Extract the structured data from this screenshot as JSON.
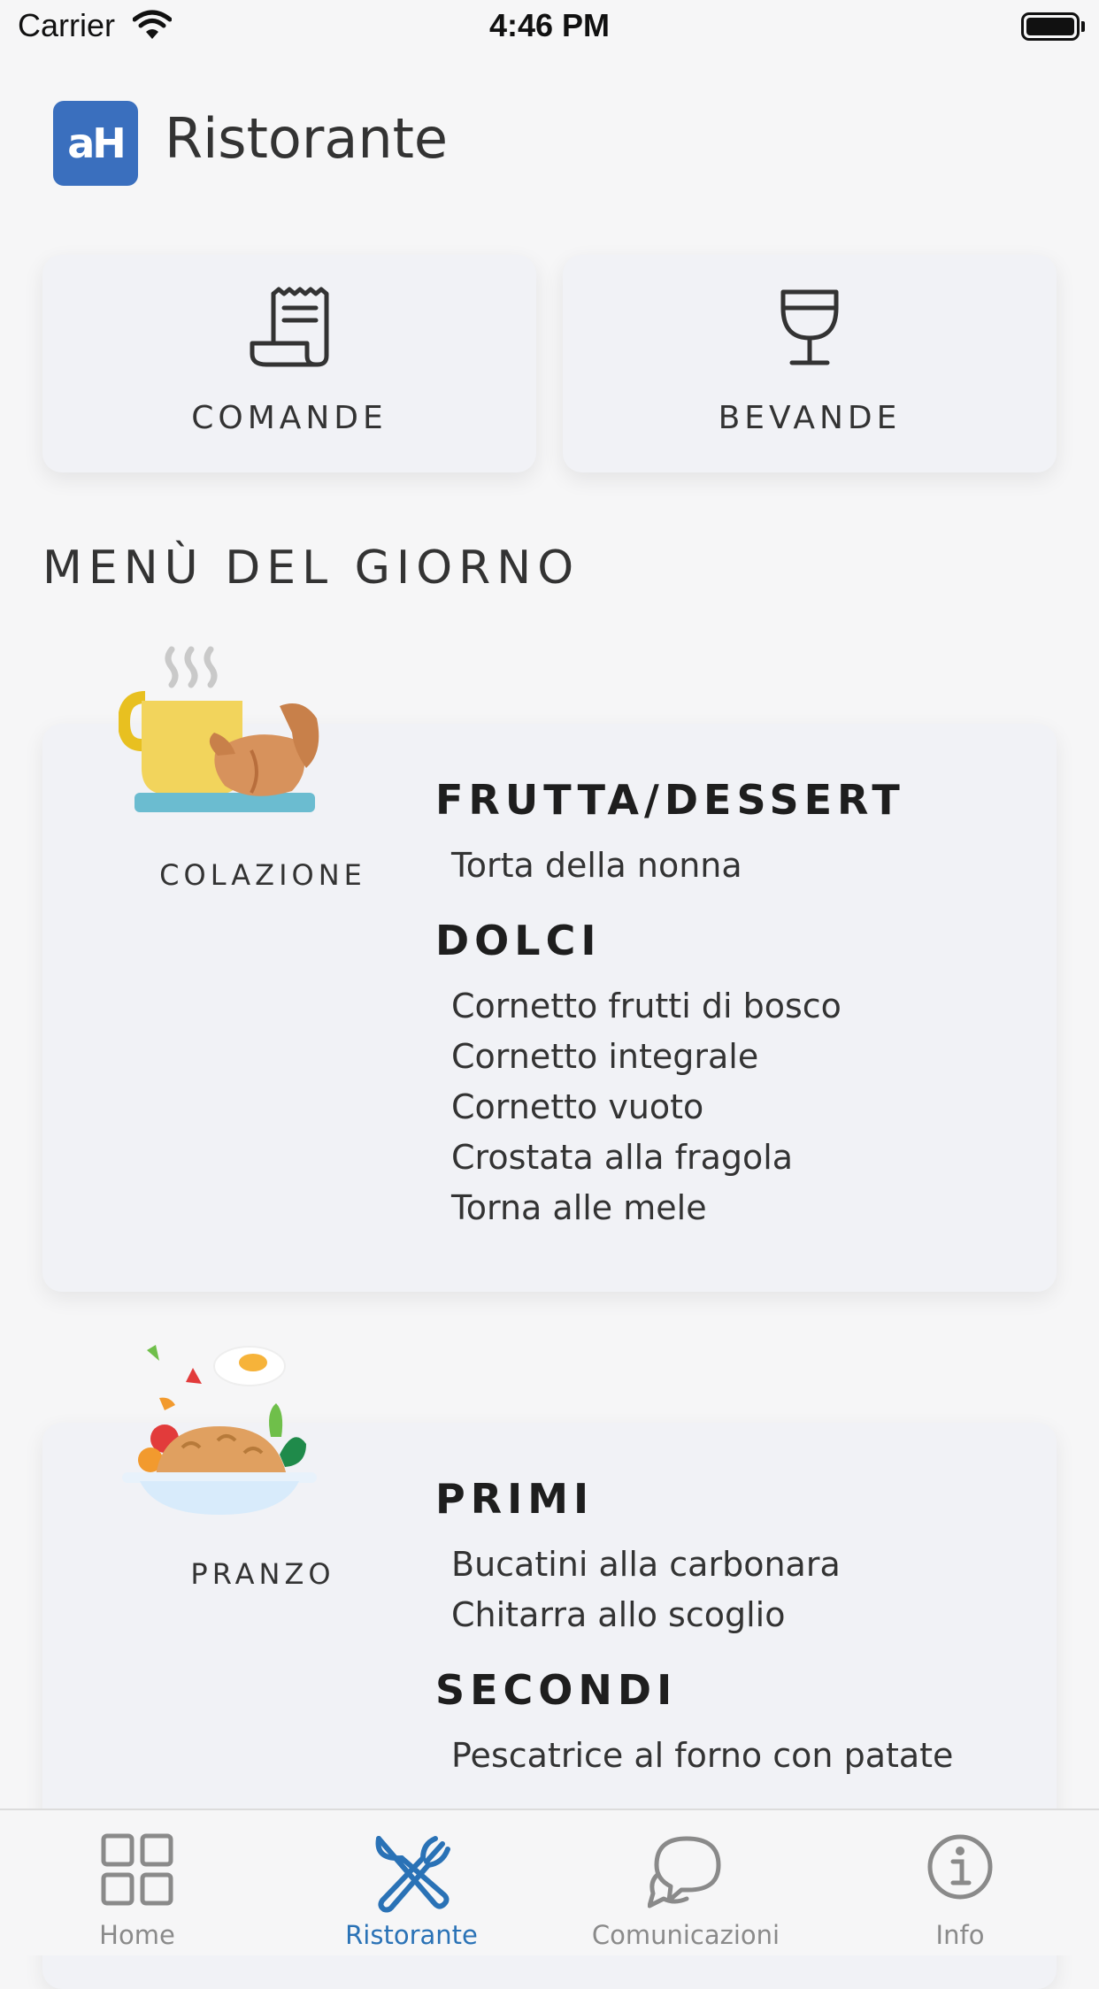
{
  "status_bar": {
    "carrier": "Carrier",
    "time": "4:46 PM"
  },
  "header": {
    "logo_text": "aH",
    "title": "Ristorante"
  },
  "tiles": [
    {
      "label": "COMANDE",
      "icon": "receipt-icon"
    },
    {
      "label": "BEVANDE",
      "icon": "wine-glass-icon"
    }
  ],
  "section_title": "MENÙ DEL GIORNO",
  "meals": [
    {
      "label": "COLAZIONE",
      "icon": "breakfast-coffee-croissant-icon",
      "groups": [
        {
          "title": "FRUTTA/DESSERT",
          "items": [
            "Torta della nonna"
          ]
        },
        {
          "title": "DOLCI",
          "items": [
            "Cornetto frutti di bosco",
            "Cornetto integrale",
            "Cornetto vuoto",
            "Crostata alla fragola",
            "Torna alle mele"
          ]
        }
      ]
    },
    {
      "label": "PRANZO",
      "icon": "lunch-plate-icon",
      "groups": [
        {
          "title": "PRIMI",
          "items": [
            "Bucatini alla carbonara",
            "Chitarra allo scoglio"
          ]
        },
        {
          "title": "SECONDI",
          "items": [
            "Pescatrice al forno con patate"
          ]
        }
      ]
    }
  ],
  "tab_bar": {
    "tabs": [
      {
        "label": "Home",
        "icon": "grid-icon",
        "active": false
      },
      {
        "label": "Ristorante",
        "icon": "cutlery-icon",
        "active": true
      },
      {
        "label": "Comunicazioni",
        "icon": "chat-bubbles-icon",
        "active": false
      },
      {
        "label": "Info",
        "icon": "info-icon",
        "active": false
      }
    ]
  },
  "colors": {
    "accent": "#2a72b6",
    "logo": "#3a6fbe",
    "background": "#f6f6f7",
    "card": "#f1f2f6",
    "inactive": "#8a8a8a"
  }
}
